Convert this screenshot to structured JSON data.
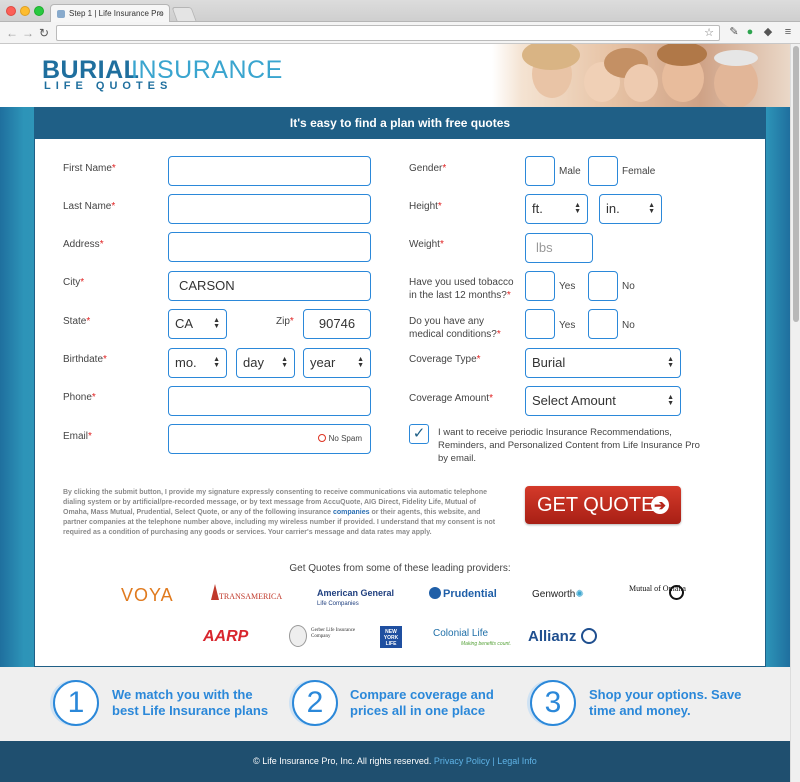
{
  "browser": {
    "tab_title": "Step 1 | Life Insurance Pro",
    "tab_close": "×"
  },
  "header": {
    "logo_bold": "BURIAL",
    "logo_light": "INSURANCE",
    "logo_sub": "LIFE QUOTES"
  },
  "panel": {
    "heading": "It's easy to find a plan with free quotes"
  },
  "form": {
    "first_name_label": "First Name",
    "last_name_label": "Last Name",
    "address_label": "Address",
    "city_label": "City",
    "city_value": "CARSON",
    "state_label": "State",
    "state_value": "CA",
    "zip_label": "Zip",
    "zip_value": "90746",
    "birthdate_label": "Birthdate",
    "birth_month": "mo.",
    "birth_day": "day",
    "birth_year": "year",
    "phone_label": "Phone",
    "email_label": "Email",
    "no_spam": "No Spam",
    "gender_label": "Gender",
    "gender_male": "Male",
    "gender_female": "Female",
    "height_label": "Height",
    "height_ft": "ft.",
    "height_in": "in.",
    "weight_label": "Weight",
    "weight_placeholder": "lbs",
    "tobacco_label_1": "Have you used tobacco",
    "tobacco_label_2": "in the last 12 months?",
    "tobacco_yes": "Yes",
    "tobacco_no": "No",
    "medical_label_1": "Do you have any",
    "medical_label_2": "medical conditions?",
    "medical_yes": "Yes",
    "medical_no": "No",
    "coverage_type_label": "Coverage Type",
    "coverage_type_value": "Burial",
    "coverage_amount_label": "Coverage Amount",
    "coverage_amount_value": "Select Amount",
    "optin_checked_mark": "✓",
    "optin_text": "I want to receive periodic Insurance Recommendations, Reminders, and Personalized Content from Life Insurance Pro by email.",
    "required_mark": "*"
  },
  "disclaimer": {
    "text_before": "By clicking the submit button, I provide my signature expressly consenting to receive communications via automatic telephone dialing system or by artificial/pre-recorded message, or by text message from AccuQuote, AIG Direct, Fidelity Life, Mutual of Omaha, Mass Mutual, Prudential, Select Quote, or any of the following insurance ",
    "link": "companies",
    "text_after": " or their agents, this website, and partner companies at the telephone number above, including my wireless number if provided. I understand that my consent is not required as a condition of purchasing any goods or services. Your carrier's message and data rates may apply."
  },
  "cta": {
    "label": "GET QUOTES",
    "arrow": "➔"
  },
  "providers": {
    "heading": "Get Quotes from some of these leading providers:",
    "voya": "VOYA",
    "transamerica": "TRANSAMERICA",
    "american_general": "American General",
    "american_general_sub": "Life Companies",
    "prudential": "Prudential",
    "genworth": "Genworth",
    "mutual_omaha": "Mutual of Omaha",
    "aarp": "AARP",
    "gerber": "Gerber Life Insurance Company",
    "ny_life": "NEW YORK LIFE",
    "colonial": "Colonial Life",
    "colonial_sub": "Making benefits count.",
    "allianz": "Allianz"
  },
  "steps": [
    {
      "number": "1",
      "line1": "We match you with the",
      "line2": "best Life Insurance plans"
    },
    {
      "number": "2",
      "line1": "Compare coverage and",
      "line2": "prices all in one place"
    },
    {
      "number": "3",
      "line1": "Shop your options. Save",
      "line2": "time and money."
    }
  ],
  "footer": {
    "copyright": "© Life Insurance Pro, Inc. All rights reserved.",
    "privacy": "Privacy Policy",
    "separator": "|",
    "legal": "Legal Info"
  },
  "colors": {
    "brand_dark": "#1f5f86",
    "brand_light": "#3aa5cf",
    "input_border": "#2b88d9",
    "cta": "#c32b1e",
    "footer": "#1f4f6f"
  },
  "icons": [
    "back-icon",
    "forward-icon",
    "reload-icon",
    "star-icon",
    "menu-icon",
    "no-spam-icon",
    "arrow-right-icon",
    "dropdown-arrow-icon"
  ]
}
